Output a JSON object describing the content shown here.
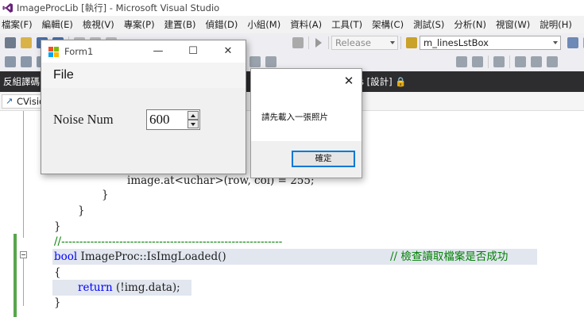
{
  "window": {
    "title": "ImageProcLib [執行] - Microsoft Visual Studio"
  },
  "menu": [
    "檔案(F)",
    "編輯(E)",
    "檢視(V)",
    "專案(P)",
    "建置(B)",
    "偵錯(D)",
    "小組(M)",
    "資料(A)",
    "工具(T)",
    "架構(C)",
    "測試(S)",
    "分析(N)",
    "視窗(W)",
    "說明(H)"
  ],
  "toolbar": {
    "config_select": "Release",
    "member_select": "m_linesLstBox"
  },
  "panel": {
    "title": "反組譯碼",
    "designer_tab": "s [設計]"
  },
  "nav": {
    "class_dropdown": "CVisio"
  },
  "code": {
    "line1": "image.at<uchar>(row, col) = 255;",
    "line2": "}",
    "line3": "}",
    "line4": "}",
    "separator": "//-------------------------------------------------------------",
    "func_kw": "bool",
    "func_sig": " ImageProc::IsImgLoaded()",
    "func_comment": "// 檢查讀取檔案是否成功",
    "open_brace": "{",
    "return_kw": "return",
    "return_expr": " (!img.data);",
    "close_brace": "}"
  },
  "form1": {
    "title": "Form1",
    "minimize": "—",
    "maximize": "☐",
    "close": "✕",
    "file_menu": "File",
    "noise_label": "Noise Num",
    "noise_value": "600"
  },
  "msgbox": {
    "close": "✕",
    "message": "請先載入一張照片",
    "ok_label": "確定"
  },
  "colors": {
    "accent": "#0078d7",
    "tab_strip": "#2d2d30",
    "keyword": "#0000ff",
    "comment": "#008000"
  }
}
